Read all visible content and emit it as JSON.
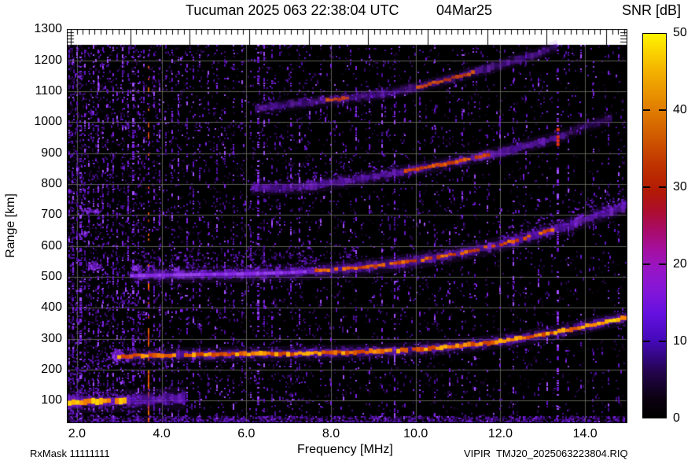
{
  "header": {
    "title": "Tucuman 2025 063 22:38:04 UTC",
    "date": "04Mar25"
  },
  "colorbar": {
    "label": "SNR [dB]",
    "min": 0,
    "max": 50,
    "tick_values": [
      0,
      10,
      20,
      30,
      40,
      50
    ],
    "tick_labels": [
      "0",
      "10",
      "20",
      "30",
      "40",
      "50"
    ],
    "gradient_stops": [
      [
        0.0,
        "#000000"
      ],
      [
        0.05,
        "#0b0110"
      ],
      [
        0.12,
        "#24044e"
      ],
      [
        0.2,
        "#4409b8"
      ],
      [
        0.27,
        "#6410e0"
      ],
      [
        0.33,
        "#8316d8"
      ],
      [
        0.39,
        "#9815c4"
      ],
      [
        0.44,
        "#a50f9e"
      ],
      [
        0.49,
        "#a90b66"
      ],
      [
        0.54,
        "#ad0e2c"
      ],
      [
        0.59,
        "#b21a04"
      ],
      [
        0.66,
        "#c03400"
      ],
      [
        0.74,
        "#d25e00"
      ],
      [
        0.82,
        "#e48600"
      ],
      [
        0.9,
        "#f3b000"
      ],
      [
        0.96,
        "#fbd800"
      ],
      [
        1.0,
        "#fdf500"
      ]
    ]
  },
  "axes": {
    "x_label": "Frequency [MHz]",
    "y_label": "Range [km]",
    "x_ticks": [
      {
        "v": 2,
        "label": "2.0"
      },
      {
        "v": 4,
        "label": "4.0"
      },
      {
        "v": 6,
        "label": "6.0"
      },
      {
        "v": 8,
        "label": "8.0"
      },
      {
        "v": 10,
        "label": "10.0"
      },
      {
        "v": 12,
        "label": "12.0"
      },
      {
        "v": 14,
        "label": "14.0"
      }
    ],
    "y_ticks": [
      {
        "v": 100,
        "label": "100"
      },
      {
        "v": 200,
        "label": "200"
      },
      {
        "v": 300,
        "label": "300"
      },
      {
        "v": 400,
        "label": "400"
      },
      {
        "v": 500,
        "label": "500"
      },
      {
        "v": 600,
        "label": "600"
      },
      {
        "v": 700,
        "label": "700"
      },
      {
        "v": 800,
        "label": "800"
      },
      {
        "v": 900,
        "label": "900"
      },
      {
        "v": 1000,
        "label": "1000"
      },
      {
        "v": 1100,
        "label": "1100"
      },
      {
        "v": 1200,
        "label": "1200"
      },
      {
        "v": 1300,
        "label": "1300"
      }
    ]
  },
  "footer": {
    "left": "RxMask 11111111",
    "right": "VIPIR  TMJ20_2025063223804.RIQ"
  },
  "chart_data": {
    "type": "heatmap",
    "title": "Tucuman 2025 063 22:38:04 UTC",
    "subtitle": "04Mar25",
    "xlabel": "Frequency [MHz]",
    "ylabel": "Range [km]",
    "zlabel": "SNR [dB]",
    "x_range": [
      1.76,
      15.0
    ],
    "y_range": [
      30,
      1300
    ],
    "data_y_max": 1250,
    "z_range": [
      0,
      50
    ],
    "grid": {
      "on": true,
      "x_step_mhz": 2,
      "y_step_km": 100,
      "color": "#6b6b62"
    },
    "background": "#000000",
    "echo_traces": [
      {
        "name": "E-layer echo",
        "points": [
          [
            1.78,
            94
          ],
          [
            2.1,
            96
          ],
          [
            2.6,
            98
          ],
          [
            3.0,
            99
          ],
          [
            3.2,
            100
          ],
          [
            3.6,
            103
          ],
          [
            4.5,
            108
          ]
        ],
        "core": [
          [
            1.78,
            3.2
          ]
        ],
        "core_gap": 0.05,
        "core_palette": [
          "#ff9e00",
          "#ffb400",
          "#f27c00",
          "#ffd000"
        ],
        "core_h": 7,
        "halo_h": 16,
        "halo_a": 0.5
      },
      {
        "name": "F-layer 1st hop",
        "points": [
          [
            2.95,
            243
          ],
          [
            3.3,
            245
          ],
          [
            4.0,
            247
          ],
          [
            5.0,
            249
          ],
          [
            6.0,
            251
          ],
          [
            7.0,
            252
          ],
          [
            8.0,
            255
          ],
          [
            9.0,
            259
          ],
          [
            9.8,
            264
          ],
          [
            10.6,
            272
          ],
          [
            11.4,
            282
          ],
          [
            12.0,
            292
          ],
          [
            12.6,
            304
          ],
          [
            13.2,
            318
          ],
          [
            13.8,
            335
          ],
          [
            14.4,
            352
          ],
          [
            15.0,
            369
          ]
        ],
        "core": [
          [
            2.95,
            15.0
          ]
        ],
        "core_gap": 0.06,
        "core_palette": [
          "#f07800",
          "#e05800",
          "#ff9800",
          "#d04000",
          "#ffb000"
        ],
        "bright_tail": 13.9,
        "core_h": 5,
        "halo_h": 11,
        "halo_a": 0.45
      },
      {
        "name": "F-layer 2nd hop",
        "points": [
          [
            3.25,
            504
          ],
          [
            4.0,
            506
          ],
          [
            5.0,
            508
          ],
          [
            6.0,
            510
          ],
          [
            7.0,
            514
          ],
          [
            8.0,
            522
          ],
          [
            8.8,
            531
          ],
          [
            9.6,
            544
          ],
          [
            10.4,
            561
          ],
          [
            11.2,
            581
          ],
          [
            12.0,
            605
          ],
          [
            12.8,
            634
          ],
          [
            13.6,
            667
          ],
          [
            14.3,
            698
          ],
          [
            15.0,
            731
          ]
        ],
        "core": [
          [
            7.4,
            13.3
          ]
        ],
        "core_gap": 0.22,
        "core_palette": [
          "#d84800",
          "#e86000",
          "#c23600",
          "#f07400"
        ],
        "purple_core": [
          [
            3.25,
            7.4
          ]
        ],
        "core_h": 4,
        "halo_h": 12,
        "halo_a": 0.5
      },
      {
        "name": "F-layer 3rd hop",
        "points": [
          [
            6.1,
            786
          ],
          [
            6.7,
            787
          ],
          [
            7.4,
            791
          ],
          [
            8.2,
            806
          ],
          [
            9.0,
            824
          ],
          [
            9.8,
            843
          ],
          [
            10.6,
            863
          ],
          [
            11.4,
            885
          ],
          [
            12.2,
            909
          ],
          [
            13.0,
            937
          ],
          [
            13.5,
            958
          ],
          [
            14.0,
            986
          ],
          [
            14.6,
            1012
          ]
        ],
        "core": [
          [
            9.7,
            11.75
          ]
        ],
        "core_gap": 0.15,
        "core_palette": [
          "#d84800",
          "#e86000",
          "#c23600"
        ],
        "fade_after": 13.5,
        "core_h": 4,
        "halo_h": 10,
        "halo_a": 0.45
      },
      {
        "name": "F-layer 4th hop",
        "points": [
          [
            6.2,
            1042
          ],
          [
            7.0,
            1056
          ],
          [
            7.9,
            1070
          ],
          [
            8.6,
            1081
          ],
          [
            9.3,
            1093
          ],
          [
            9.9,
            1109
          ],
          [
            10.5,
            1129
          ],
          [
            11.1,
            1151
          ],
          [
            11.7,
            1173
          ],
          [
            12.3,
            1197
          ],
          [
            12.9,
            1223
          ],
          [
            13.3,
            1244
          ]
        ],
        "core": [
          [
            7.85,
            8.45
          ],
          [
            10.0,
            11.45
          ]
        ],
        "core_gap": 0.2,
        "core_palette": [
          "#d84800",
          "#c23600",
          "#e86000"
        ],
        "alpha": 0.85,
        "core_h": 4,
        "halo_h": 9,
        "halo_a": 0.4
      }
    ],
    "hot_spots": [
      {
        "f": 13.36,
        "r0": 928,
        "r1": 988,
        "color": "#e03010"
      }
    ],
    "rfi_hot_line": {
      "f": 3.7,
      "strong_r": [
        [
          25,
          200
        ],
        [
          230,
          330
        ],
        [
          450,
          485
        ]
      ],
      "s": 0.5
    },
    "rfi_stripes": [
      [
        1.82,
        0.5
      ],
      [
        1.9,
        0.62
      ],
      [
        2.0,
        0.5
      ],
      [
        2.08,
        0.72
      ],
      [
        2.18,
        0.5
      ],
      [
        2.28,
        0.6
      ],
      [
        2.4,
        0.5
      ],
      [
        2.5,
        0.66
      ],
      [
        2.62,
        0.5
      ],
      [
        2.72,
        0.6
      ],
      [
        2.85,
        0.56
      ],
      [
        2.95,
        0.5
      ],
      [
        3.08,
        0.62
      ],
      [
        3.2,
        0.56
      ],
      [
        3.32,
        0.82
      ],
      [
        3.45,
        0.6
      ],
      [
        3.58,
        0.5
      ],
      [
        3.82,
        0.52
      ],
      [
        3.95,
        0.6
      ],
      [
        4.1,
        0.5
      ],
      [
        4.25,
        0.62
      ],
      [
        4.4,
        0.55
      ],
      [
        4.6,
        0.5
      ],
      [
        4.75,
        0.6
      ],
      [
        4.9,
        0.5
      ],
      [
        5.1,
        0.46
      ],
      [
        5.3,
        0.5
      ],
      [
        5.5,
        0.42
      ],
      [
        5.7,
        0.56
      ],
      [
        5.9,
        0.42
      ],
      [
        6.1,
        0.5
      ],
      [
        6.28,
        0.88
      ],
      [
        6.42,
        0.6
      ],
      [
        6.6,
        0.42
      ],
      [
        6.8,
        0.36
      ],
      [
        7.05,
        0.55
      ],
      [
        7.25,
        0.4
      ],
      [
        7.5,
        0.36
      ],
      [
        7.75,
        0.3
      ],
      [
        8.0,
        0.36
      ],
      [
        8.3,
        0.3
      ],
      [
        8.6,
        0.46
      ],
      [
        8.9,
        0.3
      ],
      [
        9.2,
        0.36
      ],
      [
        9.5,
        0.7
      ],
      [
        9.75,
        0.36
      ],
      [
        10.1,
        0.42
      ],
      [
        10.45,
        0.3
      ],
      [
        10.8,
        0.36
      ],
      [
        11.1,
        0.46
      ],
      [
        11.4,
        0.3
      ],
      [
        11.7,
        0.36
      ],
      [
        12.0,
        0.3
      ],
      [
        12.3,
        0.5
      ],
      [
        12.6,
        0.32
      ],
      [
        12.9,
        0.46
      ],
      [
        13.1,
        0.36
      ],
      [
        13.35,
        0.72
      ],
      [
        13.6,
        0.3
      ],
      [
        13.9,
        0.26
      ],
      [
        14.2,
        0.3
      ],
      [
        14.55,
        0.42
      ],
      [
        14.8,
        0.3
      ]
    ],
    "clouds": [
      {
        "f": [
          1.76,
          3.5
        ],
        "r_low": [
          85,
          95
        ],
        "r_high": [
          140,
          118
        ],
        "density": 0.5
      },
      {
        "f": [
          3.5,
          4.6
        ],
        "r_low": [
          95,
          100
        ],
        "r_high": [
          118,
          112
        ],
        "density": 0.2
      },
      {
        "f": [
          1.8,
          3.2
        ],
        "r_low": [
          185,
          228
        ],
        "r_high": [
          242,
          250
        ],
        "density": 0.28
      },
      {
        "f": [
          1.76,
          3.4
        ],
        "r_low": [
          55,
          58
        ],
        "r_high": [
          85,
          85
        ],
        "density": 0.12
      },
      {
        "f": [
          3.4,
          8.6
        ],
        "r_low": [
          512,
          530
        ],
        "r_high": [
          588,
          600
        ],
        "density": 0.3,
        "patchy": true
      },
      {
        "f": [
          11.9,
          14.95
        ],
        "r_low": [
          600,
          735
        ],
        "r_high": [
          652,
          800
        ],
        "density": 0.3
      },
      {
        "f": [
          6.1,
          9.5
        ],
        "r_low": [
          788,
          832
        ],
        "r_high": [
          822,
          872
        ],
        "density": 0.18
      },
      {
        "f": [
          6.2,
          9.6
        ],
        "r_low": [
          1040,
          1092
        ],
        "r_high": [
          1076,
          1124
        ],
        "density": 0.13
      },
      {
        "f": [
          1.76,
          15.0
        ],
        "r_low": [
          30,
          30
        ],
        "r_high": [
          52,
          52
        ],
        "density": 0.5
      }
    ],
    "blobs": [
      {
        "f": 2.92,
        "r": 250,
        "df": 10,
        "dr": 13,
        "n": 130
      },
      {
        "f": 2.4,
        "r": 538,
        "df": 11,
        "dr": 10,
        "n": 70
      },
      {
        "f": 3.38,
        "r": 532,
        "df": 7,
        "dr": 8,
        "n": 45
      },
      {
        "f": 4.35,
        "r": 525,
        "df": 6,
        "dr": 7,
        "n": 30
      },
      {
        "f": 2.3,
        "r": 716,
        "df": 16,
        "dr": 7,
        "n": 55
      },
      {
        "f": 2.15,
        "r": 640,
        "df": 8,
        "dr": 6,
        "n": 25
      }
    ],
    "noise": {
      "seed": 20250363,
      "base_density": 0.075,
      "low_band_boost": 4.3,
      "clutter_below_km": 52
    }
  }
}
